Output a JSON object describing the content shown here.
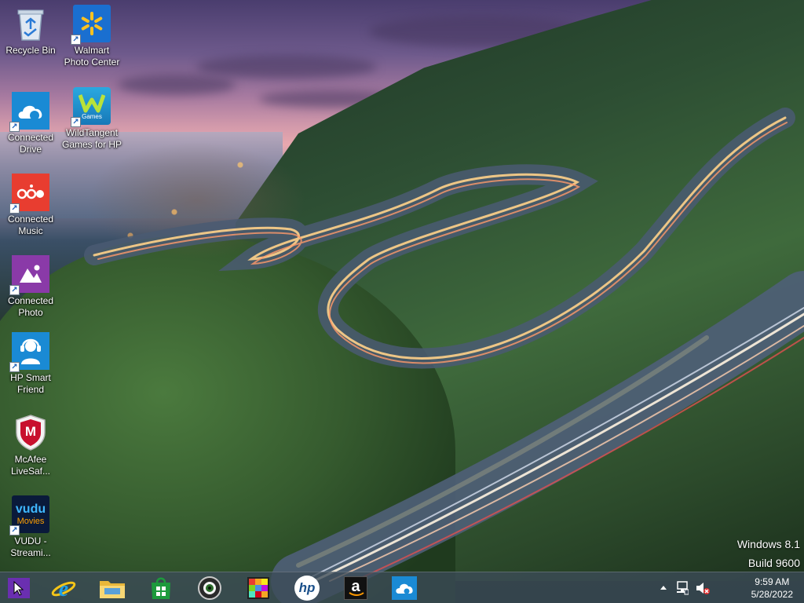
{
  "desktop": {
    "icons": [
      {
        "label": "Recycle Bin",
        "icon": "recycle-bin-icon"
      },
      {
        "label": "Walmart Photo Center",
        "icon": "walmart-icon"
      },
      {
        "label": "Connected Drive",
        "icon": "cloud-drive-icon"
      },
      {
        "label": "WildTangent Games for HP",
        "icon": "wildtangent-icon",
        "tile_text": "Games"
      },
      {
        "label": "Connected Music",
        "icon": "music-icon"
      },
      {
        "label": "Connected Photo",
        "icon": "photo-icon"
      },
      {
        "label": "HP Smart Friend",
        "icon": "support-headset-icon"
      },
      {
        "label": "McAfee LiveSaf...",
        "icon": "mcafee-shield-icon",
        "tile_text": "M"
      },
      {
        "label": "VUDU - Streami...",
        "icon": "vudu-icon",
        "tile_text": "vudu",
        "tile_subtext": "Movies"
      }
    ],
    "brand_mark": "hp"
  },
  "watermark": {
    "line1": "Windows 8.1",
    "line2": "Build 9600"
  },
  "taskbar": {
    "pinned": [
      {
        "name": "internet-explorer",
        "icon": "internet-explorer-icon"
      },
      {
        "name": "file-explorer",
        "icon": "folder-icon"
      },
      {
        "name": "store",
        "icon": "store-icon"
      },
      {
        "name": "camera-app",
        "icon": "camera-icon"
      },
      {
        "name": "photo-app",
        "icon": "colorful-grid-icon"
      },
      {
        "name": "hp",
        "icon": "hp-logo-icon",
        "text": "hp"
      },
      {
        "name": "amazon",
        "icon": "amazon-icon",
        "text": "a"
      },
      {
        "name": "connected-drive",
        "icon": "cloud-drive-icon"
      }
    ],
    "tray": {
      "time": "9:59 AM",
      "date": "5/28/2022"
    }
  },
  "colors": {
    "taskbar": "#3c4b58",
    "start_square": "#6a2fb0",
    "hp_blue": "#1a8ad4",
    "hp_red": "#e83d30",
    "hp_purple": "#8a3aa8",
    "store_green": "#1d9a3c"
  }
}
